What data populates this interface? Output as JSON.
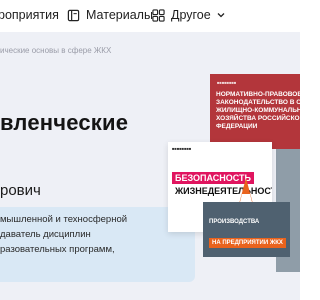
{
  "nav": {
    "events_label": "роприятия",
    "materials_label": "Материалы",
    "more_label": "Другое"
  },
  "hero": {
    "breadcrumb": "ические основы в сфере ЖКХ",
    "title": "вленческие",
    "author": "рович",
    "desc_lines": [
      "мышленной и техносферной",
      "даватель дисциплин",
      "разовательных программ,"
    ]
  },
  "covers": {
    "red_lines": [
      "НОРМАТИВНО-ПРАВОВОЕ",
      "ЗАКОНОДАТЕЛЬСТВО В СФЕРЕ",
      "ЖИЛИЩНО-КОММУНАЛЬНОГО",
      "ХОЗЯЙСТВА РОССИЙСКОЙ",
      "ФЕДЕРАЦИИ"
    ],
    "safety_band1": "БЕЗОПАСНОСТЬ",
    "safety_band2": "ЖИЗНЕДЕЯТЕЛЬНОСТИ",
    "production_line": "ПРОИЗВОДСТВА",
    "production_band": "НА ПРЕДПРИЯТИИ ЖКХ"
  },
  "colors": {
    "hero_bg": "#eef0f6",
    "desc_box": "#d9e8f5",
    "red_cover": "#b3363b",
    "pink_band": "#e0155f",
    "orange_band": "#e9631d"
  }
}
